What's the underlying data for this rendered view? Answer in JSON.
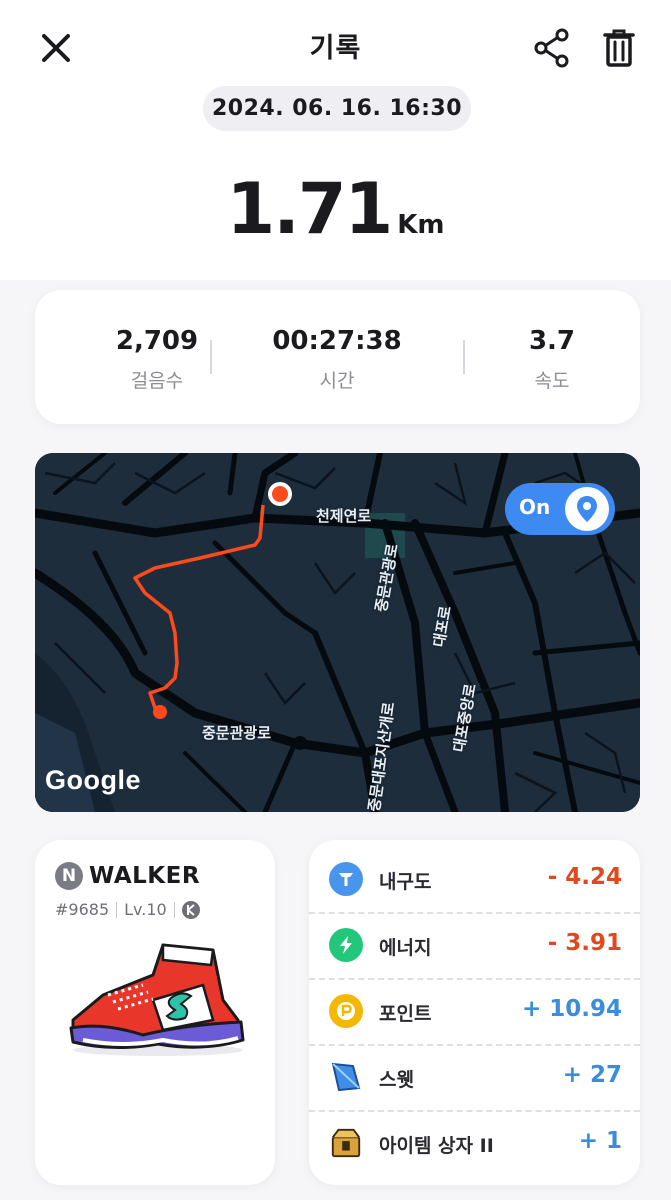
{
  "header": {
    "title": "기록",
    "close_icon": "close-icon",
    "share_icon": "share-icon",
    "trash_icon": "trash-icon"
  },
  "session": {
    "date": "2024. 06. 16. 16:30",
    "distance_value": "1.71",
    "distance_unit": "Km"
  },
  "stats": [
    {
      "value": "2,709",
      "label": "걸음수"
    },
    {
      "value": "00:27:38",
      "label": "시간"
    },
    {
      "value": "3.7",
      "label": "속도"
    }
  ],
  "map": {
    "toggle_label": "On",
    "toggle_icon": "location-pin-icon",
    "labels": {
      "road1": "천제연로",
      "road2": "중문관광로",
      "road3": "중문관광로",
      "road4": "대포로",
      "road5": "대포중앙로",
      "road6": "중문대포지산개로"
    },
    "attribution": "Google"
  },
  "walker": {
    "badge": "N",
    "name": "WALKER",
    "id": "#9685",
    "level": "Lv.10",
    "chain_icon": "klaytn-icon"
  },
  "rewards": [
    {
      "name": "내구도",
      "value": "- 4.24",
      "icon": "durability-icon",
      "color": "#4a95ec",
      "sign": "neg"
    },
    {
      "name": "에너지",
      "value": "- 3.91",
      "icon": "energy-icon",
      "color": "#22c77a",
      "sign": "neg"
    },
    {
      "name": "포인트",
      "value": "+ 10.94",
      "icon": "point-icon",
      "color": "#f5b800",
      "sign": "pos"
    },
    {
      "name": "스웻",
      "value": "+ 27",
      "icon": "sweat-icon",
      "color": "#3f8fe6",
      "sign": "pos"
    },
    {
      "name": "아이템 상자 II",
      "value": "+ 1",
      "icon": "item-box-icon",
      "color": "#d9a23a",
      "sign": "pos"
    }
  ]
}
